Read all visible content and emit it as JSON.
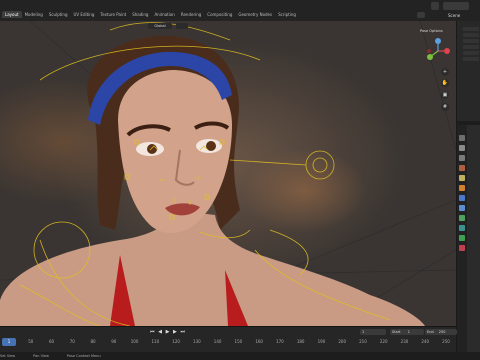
{
  "workspace_tabs": [
    "Layout",
    "Modeling",
    "Sculpting",
    "UV Editing",
    "Texture Paint",
    "Shading",
    "Animation",
    "Rendering",
    "Compositing",
    "Geometry Nodes",
    "Scripting"
  ],
  "active_tab_index": 0,
  "scene_label": "Scene",
  "viewport": {
    "mode_label": "Global",
    "pose_options_label": "Pose Options"
  },
  "timeline": {
    "current_frame": "1",
    "start_label": "Start",
    "start_value": "1",
    "end_label": "End",
    "end_value": "250",
    "current_frame_display": "1",
    "ruler_ticks": [
      "40",
      "50",
      "60",
      "70",
      "80",
      "90",
      "100",
      "110",
      "120",
      "130",
      "140",
      "150",
      "160",
      "170",
      "180",
      "190",
      "200",
      "210",
      "220",
      "230",
      "240",
      "250"
    ]
  },
  "statusbar": {
    "items": [
      "Set View",
      "Pan View",
      "Pose Context Menu"
    ]
  },
  "colors": {
    "accent": "#4772b3",
    "bone_outline": "#e0c020",
    "headband": "#2c46a8",
    "swimsuit": "#b81c1c"
  }
}
